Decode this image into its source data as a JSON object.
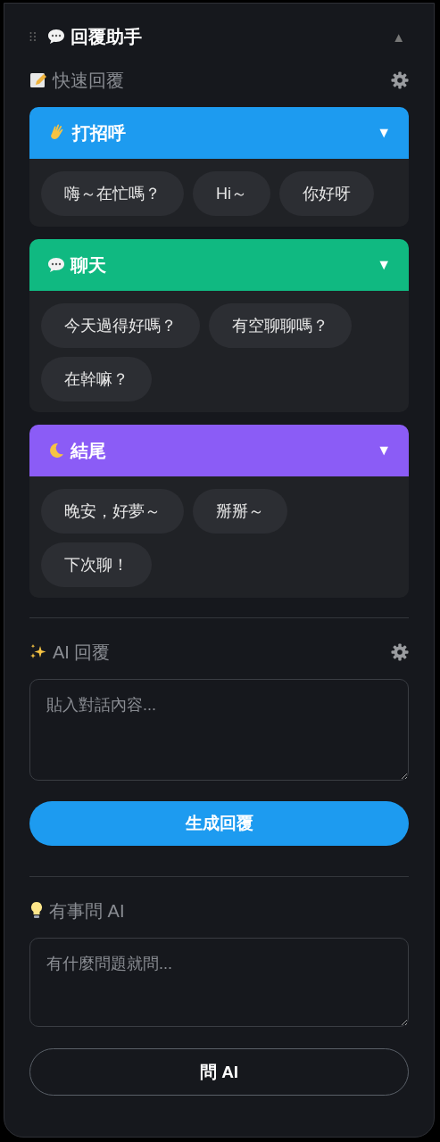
{
  "panel": {
    "title": "回覆助手",
    "collapse": "▲"
  },
  "quick_reply": {
    "heading": "快速回覆",
    "categories": [
      {
        "label": "打招呼",
        "toggle": "▼",
        "color": "#1d9bf0",
        "replies": [
          "嗨～在忙嗎？",
          "Hi～",
          "你好呀"
        ]
      },
      {
        "label": "聊天",
        "toggle": "▼",
        "color": "#10b981",
        "replies": [
          "今天過得好嗎？",
          "有空聊聊嗎？",
          "在幹嘛？"
        ]
      },
      {
        "label": "結尾",
        "toggle": "▼",
        "color": "#8b5cf6",
        "replies": [
          "晚安，好夢～",
          "掰掰～",
          "下次聊！"
        ]
      }
    ]
  },
  "ai_reply": {
    "heading": "AI 回覆",
    "placeholder": "貼入對話內容...",
    "button": "生成回覆"
  },
  "ask_ai": {
    "heading": "有事問 AI",
    "placeholder": "有什麼問題就問...",
    "button": "問 AI"
  }
}
